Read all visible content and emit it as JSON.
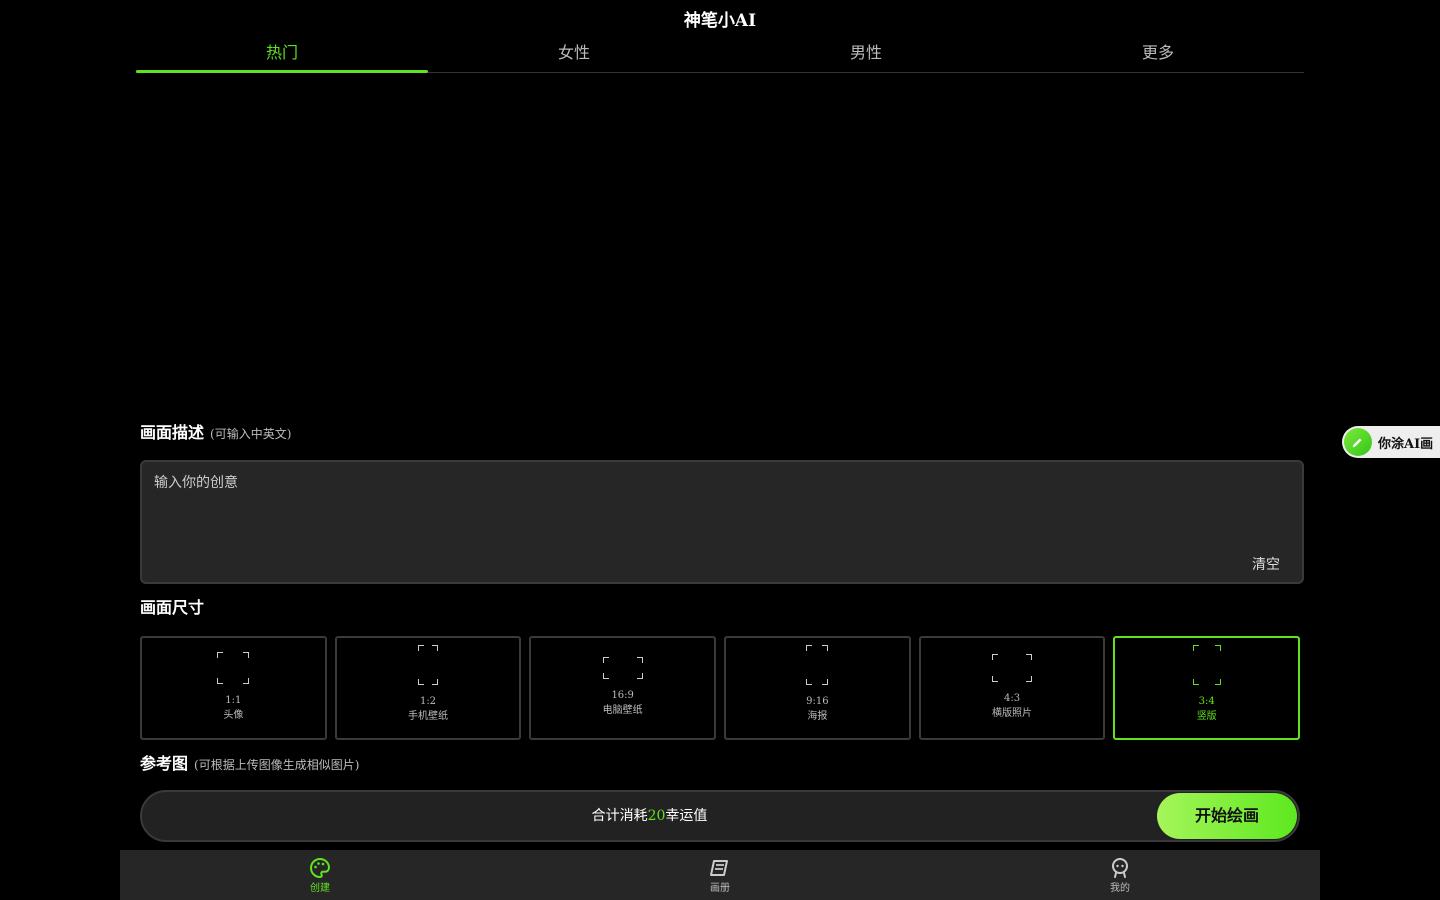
{
  "app": {
    "title": "神笔小AI"
  },
  "tabs": [
    {
      "label": "热门",
      "active": true
    },
    {
      "label": "女性"
    },
    {
      "label": "男性"
    },
    {
      "label": "更多"
    }
  ],
  "description": {
    "title": "画面描述",
    "hint": "(可输入中英文)",
    "placeholder": "输入你的创意",
    "clear_label": "清空"
  },
  "size": {
    "title": "画面尺寸",
    "options": [
      {
        "ratio": "1:1",
        "label": "头像"
      },
      {
        "ratio": "1:2",
        "label": "手机壁纸"
      },
      {
        "ratio": "16:9",
        "label": "电脑壁纸"
      },
      {
        "ratio": "9:16",
        "label": "海报"
      },
      {
        "ratio": "4:3",
        "label": "横版照片"
      },
      {
        "ratio": "3:4",
        "label": "竖版",
        "selected": true
      }
    ]
  },
  "reference": {
    "title": "参考图",
    "hint": "(可根据上传图像生成相似图片)"
  },
  "cost": {
    "prefix": "合计消耗",
    "amount": "20",
    "suffix": "幸运值",
    "start_label": "开始绘画"
  },
  "floating_badge": {
    "label": "你涂AI画",
    "icon": "pencil-icon"
  },
  "bottom_nav": [
    {
      "label": "创建",
      "icon": "palette-icon",
      "active": true
    },
    {
      "label": "画册",
      "icon": "album-icon"
    },
    {
      "label": "我的",
      "icon": "profile-icon"
    }
  ],
  "colors": {
    "accent": "#5fe31f",
    "background": "#000000",
    "surface": "#262626"
  }
}
